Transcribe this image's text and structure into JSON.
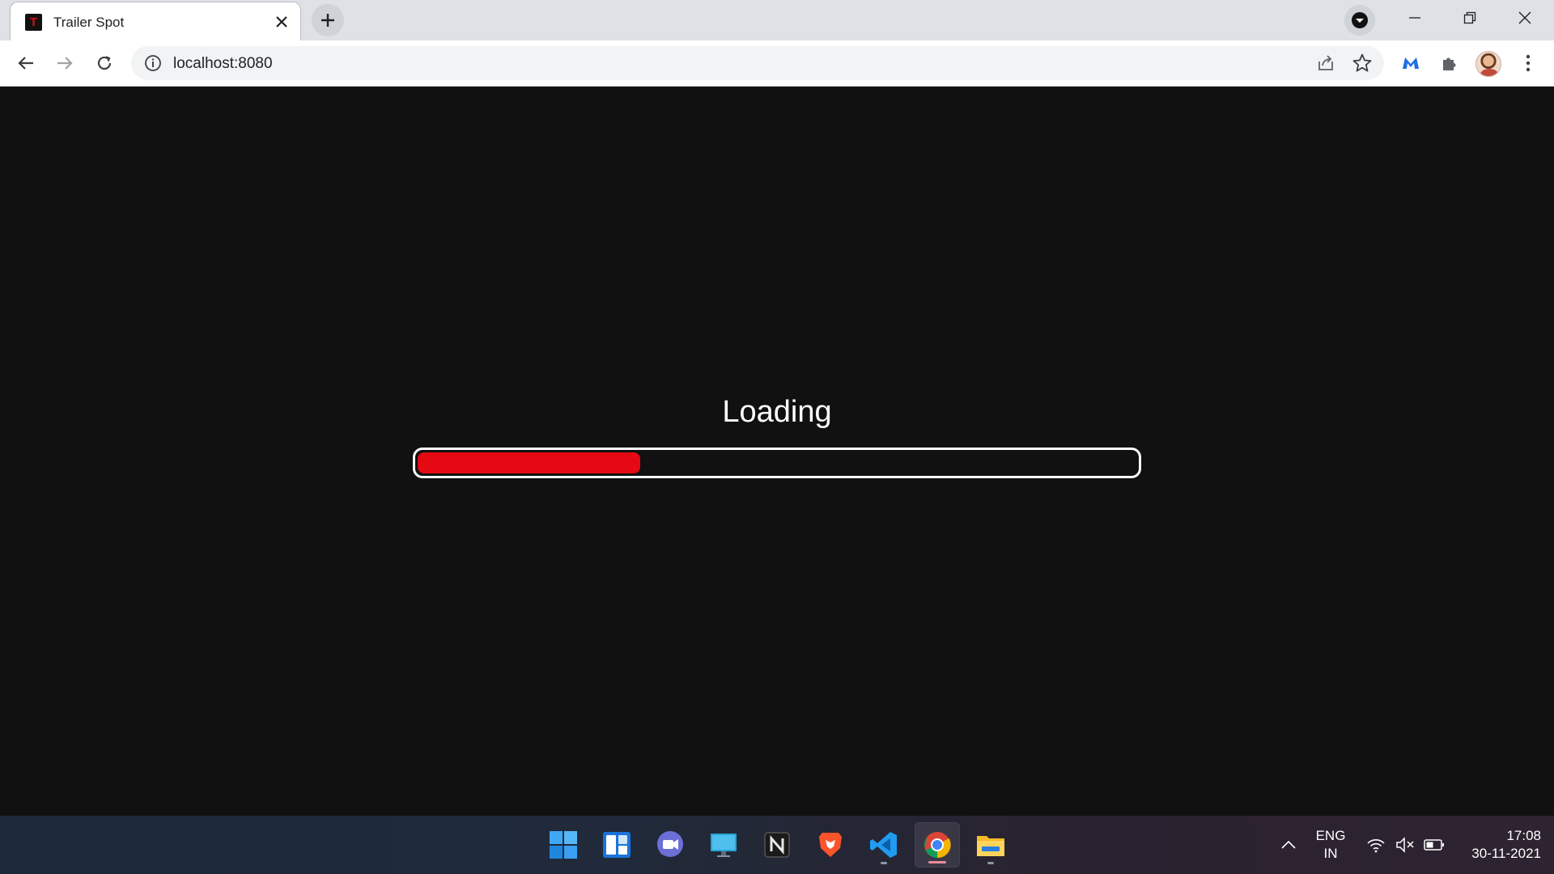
{
  "browser": {
    "tab": {
      "title": "Trailer Spot",
      "favicon_letter": "T",
      "favicon_icon": "trailer-spot-logo"
    },
    "new_tab_icon": "plus-icon",
    "address_bar": {
      "url": "localhost:8080",
      "info_icon": "info-icon"
    },
    "window_controls": [
      "minimize",
      "restore",
      "close"
    ]
  },
  "page": {
    "loading_text": "Loading",
    "progress": {
      "value_percent": 31,
      "fill_color": "#e50914",
      "border_color": "#ffffff"
    },
    "background_color": "#111111"
  },
  "taskbar": {
    "apps": [
      {
        "name": "start",
        "icon": "windows-start-icon"
      },
      {
        "name": "widgets",
        "icon": "widgets-icon"
      },
      {
        "name": "teams-chat",
        "icon": "teams-chat-icon"
      },
      {
        "name": "remote-desktop",
        "icon": "desktop-icon"
      },
      {
        "name": "notion",
        "icon": "notion-icon"
      },
      {
        "name": "brave",
        "icon": "brave-icon"
      },
      {
        "name": "vscode",
        "icon": "vscode-icon",
        "running": true
      },
      {
        "name": "chrome",
        "icon": "chrome-icon",
        "running": true,
        "active": true
      },
      {
        "name": "file-explorer",
        "icon": "folder-icon",
        "running": true
      }
    ],
    "tray": {
      "language_top": "ENG",
      "language_bottom": "IN",
      "time": "17:08",
      "date": "30-11-2021"
    }
  }
}
